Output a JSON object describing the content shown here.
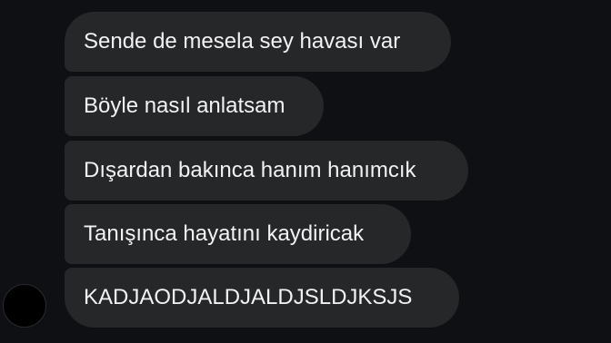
{
  "colors": {
    "background": "#0e1014",
    "bubble": "#262729",
    "text": "#f2f2f3"
  },
  "messages": [
    {
      "text": "Sende de mesela sey havası var"
    },
    {
      "text": "Böyle nasıl anlatsam"
    },
    {
      "text": "Dışardan bakınca hanım hanımcık"
    },
    {
      "text": "Tanışınca hayatını kaydiricak"
    },
    {
      "text": "KADJAODJALDJALDJSLDJKSJS"
    }
  ]
}
